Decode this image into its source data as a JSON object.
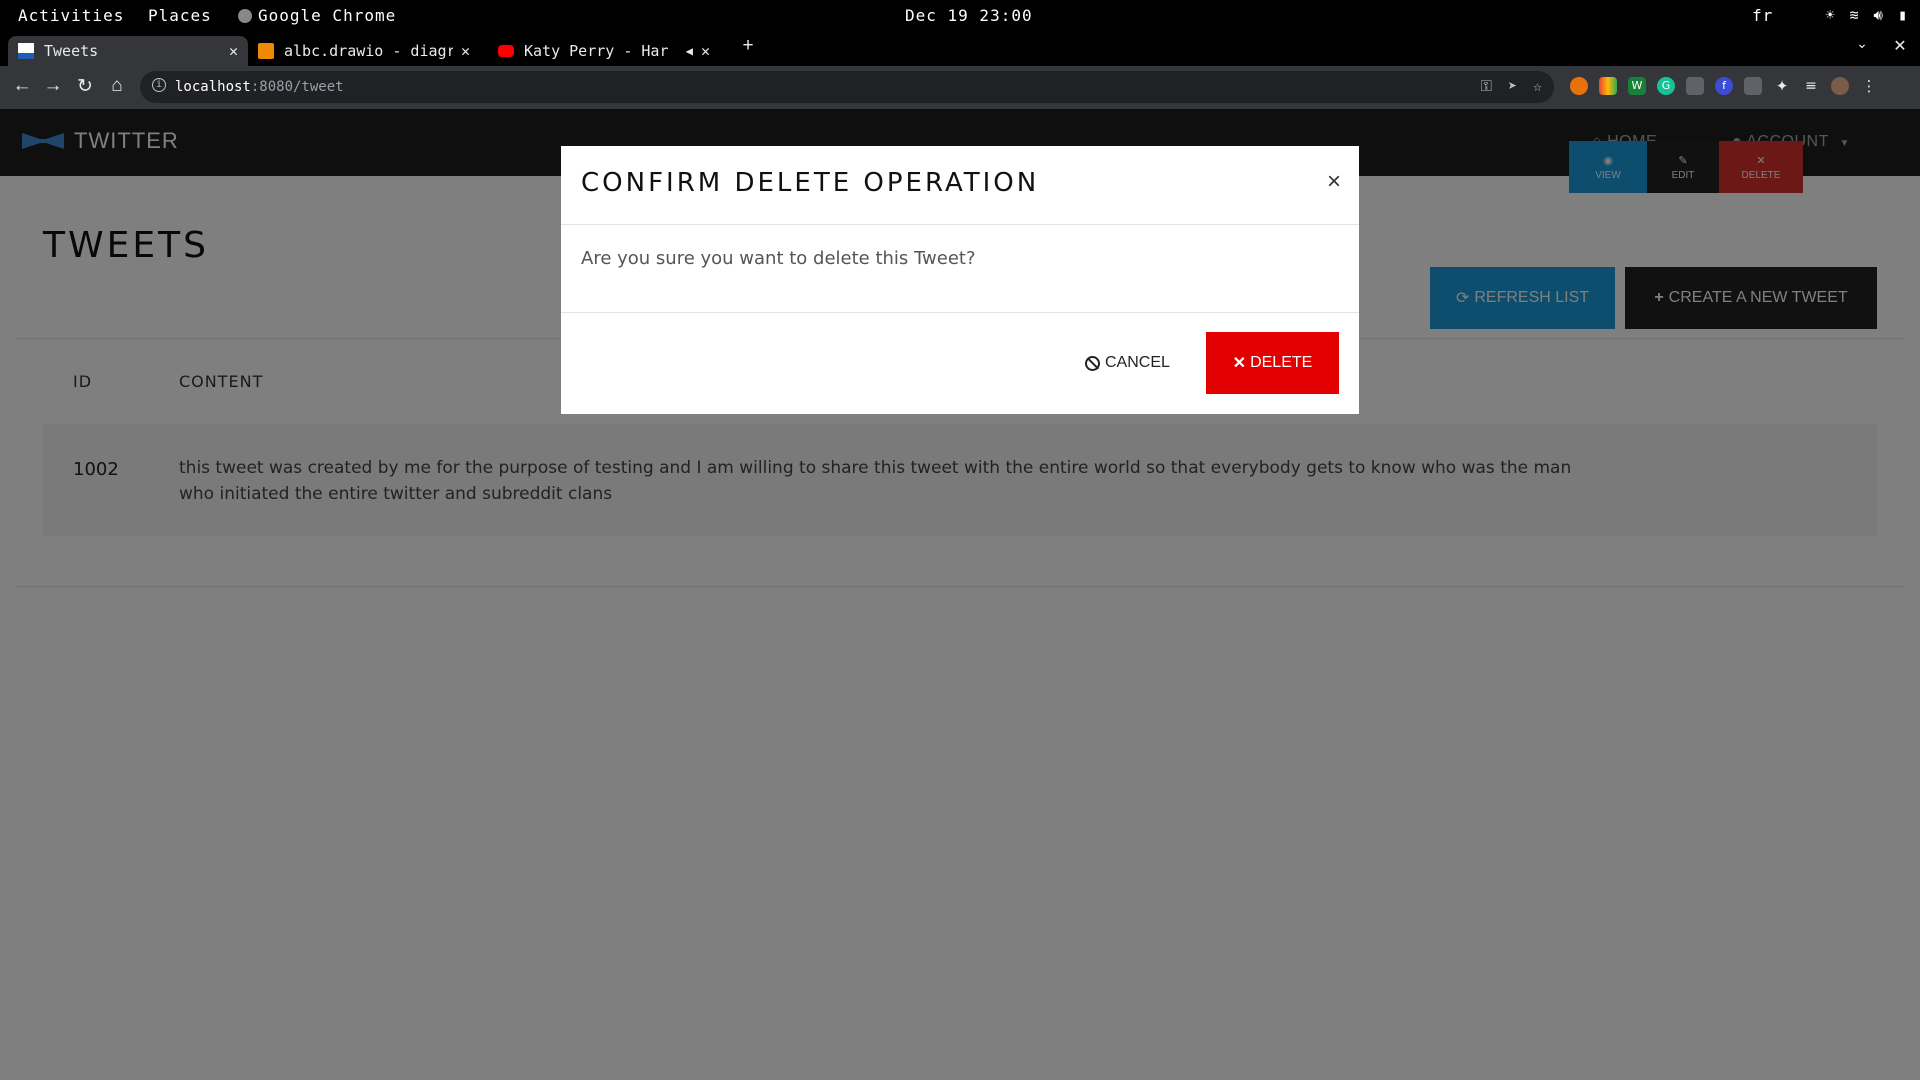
{
  "topbar": {
    "activities": "Activities",
    "places": "Places",
    "app": "Google Chrome",
    "datetime": "Dec 19 23:00",
    "lang": "fr"
  },
  "tabs": [
    {
      "title": "Tweets",
      "active": true
    },
    {
      "title": "albc.drawio - diagr",
      "active": false
    },
    {
      "title": "Katy Perry - Har",
      "active": false
    }
  ],
  "address": {
    "host": "localhost",
    "path": ":8080/tweet"
  },
  "app": {
    "brand": "TWITTER",
    "nav_home": "HOME",
    "nav_account": "ACCOUNT"
  },
  "page": {
    "title": "TWEETS",
    "refresh_label": "REFRESH LIST",
    "create_label": "CREATE A NEW TWEET",
    "headers": {
      "id": "ID",
      "content": "CONTENT"
    },
    "rows": [
      {
        "id": "1002",
        "content": "this tweet was created by me for the purpose of testing and I am willing to share this tweet with the entire world so that everybody gets to know who was the man who initiated the entire twitter and subreddit clans"
      }
    ],
    "actions": {
      "view": "VIEW",
      "edit": "EDIT",
      "delete": "DELETE"
    }
  },
  "modal": {
    "title": "CONFIRM DELETE OPERATION",
    "body": "Are you sure you want to delete this Tweet?",
    "cancel_label": "CANCEL",
    "delete_label": "DELETE"
  },
  "colors": {
    "accent_blue": "#1a9bdb",
    "danger_red": "#e30000",
    "navbar_dark": "#1f1f1f"
  }
}
